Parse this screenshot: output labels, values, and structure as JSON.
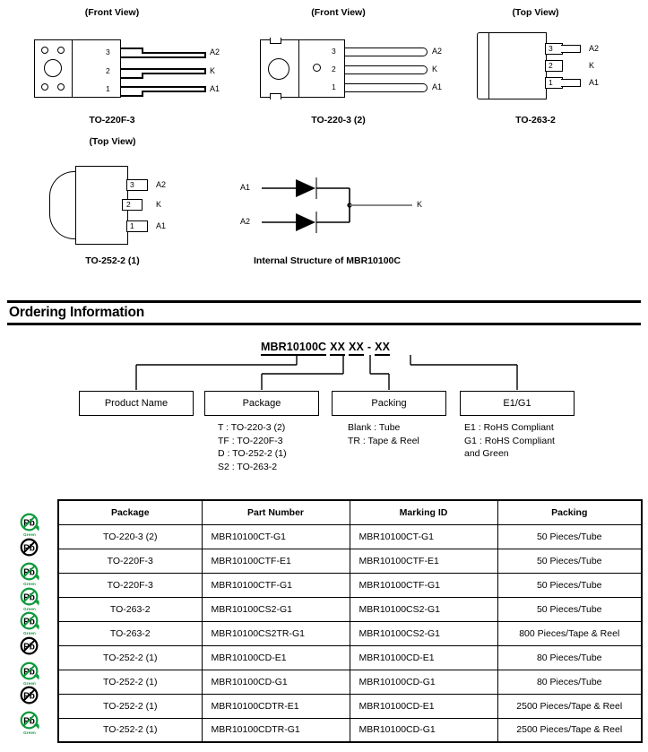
{
  "packages": [
    {
      "id": "to-220f-3",
      "view": "(Front View)",
      "name": "TO-220F-3",
      "pins": [
        {
          "num": "3",
          "label": "A2"
        },
        {
          "num": "2",
          "label": "K"
        },
        {
          "num": "1",
          "label": "A1"
        }
      ]
    },
    {
      "id": "to-220-3-2",
      "view": "(Front View)",
      "name": "TO-220-3 (2)",
      "pins": [
        {
          "num": "3",
          "label": "A2"
        },
        {
          "num": "2",
          "label": "K"
        },
        {
          "num": "1",
          "label": "A1"
        }
      ]
    },
    {
      "id": "to-263-2",
      "view": "(Top View)",
      "name": "TO-263-2",
      "pins": [
        {
          "num": "3",
          "label": "A2"
        },
        {
          "num": "2",
          "label": "K"
        },
        {
          "num": "1",
          "label": "A1"
        }
      ]
    },
    {
      "id": "to-252-2-1",
      "view": "(Top View)",
      "name": "TO-252-2 (1)",
      "pins": [
        {
          "num": "3",
          "label": "A2"
        },
        {
          "num": "2",
          "label": "K"
        },
        {
          "num": "1",
          "label": "A1"
        }
      ]
    }
  ],
  "internal_structure": {
    "caption": "Internal Structure of MBR10100C",
    "anode_1": "A1",
    "anode_2": "A2",
    "cathode": "K"
  },
  "ordering": {
    "section_title": "Ordering Information",
    "code_parts": [
      "MBR10100C",
      "XX",
      "XX",
      "-",
      "XX"
    ],
    "boxes": [
      {
        "id": "product-name",
        "label": "Product Name",
        "options": ""
      },
      {
        "id": "package",
        "label": "Package",
        "options": "T : TO-220-3 (2)\nTF : TO-220F-3\nD : TO-252-2 (1)\nS2 : TO-263-2"
      },
      {
        "id": "packing",
        "label": "Packing",
        "options": "Blank : Tube\nTR : Tape & Reel"
      },
      {
        "id": "e1-g1",
        "label": "E1/G1",
        "options": "E1 : RoHS Compliant\nG1 : RoHS Compliant\nand Green"
      }
    ]
  },
  "table": {
    "headers": [
      "Package",
      "Part Number",
      "Marking ID",
      "Packing"
    ],
    "rows": [
      {
        "icon": "pb-green-icon",
        "icon_label": "Green",
        "package": "TO-220-3 (2)",
        "part_number": "MBR10100CT-G1",
        "marking_id": "MBR10100CT-G1",
        "packing": "50 Pieces/Tube"
      },
      {
        "icon": "pb-black-icon",
        "icon_label": "",
        "package": "TO-220F-3",
        "part_number": "MBR10100CTF-E1",
        "marking_id": "MBR10100CTF-E1",
        "packing": "50 Pieces/Tube"
      },
      {
        "icon": "pb-green-icon",
        "icon_label": "Green",
        "package": "TO-220F-3",
        "part_number": "MBR10100CTF-G1",
        "marking_id": "MBR10100CTF-G1",
        "packing": "50 Pieces/Tube"
      },
      {
        "icon": "pb-green-icon",
        "icon_label": "Green",
        "package": "TO-263-2",
        "part_number": "MBR10100CS2-G1",
        "marking_id": "MBR10100CS2-G1",
        "packing": "50 Pieces/Tube"
      },
      {
        "icon": "pb-green-icon",
        "icon_label": "Green",
        "package": "TO-263-2",
        "part_number": "MBR10100CS2TR-G1",
        "marking_id": "MBR10100CS2-G1",
        "packing": "800 Pieces/Tape & Reel"
      },
      {
        "icon": "pb-black-icon",
        "icon_label": "",
        "package": "TO-252-2 (1)",
        "part_number": "MBR10100CD-E1",
        "marking_id": "MBR10100CD-E1",
        "packing": "80 Pieces/Tube"
      },
      {
        "icon": "pb-green-icon",
        "icon_label": "Green",
        "package": "TO-252-2 (1)",
        "part_number": "MBR10100CD-G1",
        "marking_id": "MBR10100CD-G1",
        "packing": "80 Pieces/Tube"
      },
      {
        "icon": "pb-black-icon",
        "icon_label": "",
        "package": "TO-252-2  (1)",
        "part_number": "MBR10100CDTR-E1",
        "marking_id": "MBR10100CD-E1",
        "packing": "2500 Pieces/Tape & Reel"
      },
      {
        "icon": "pb-green-icon",
        "icon_label": "Green",
        "package": "TO-252-2  (1)",
        "part_number": "MBR10100CDTR-G1",
        "marking_id": "MBR10100CD-G1",
        "packing": "2500 Pieces/Tape & Reel"
      }
    ]
  },
  "colors": {
    "green": "#0e9a3c",
    "black": "#000000"
  }
}
